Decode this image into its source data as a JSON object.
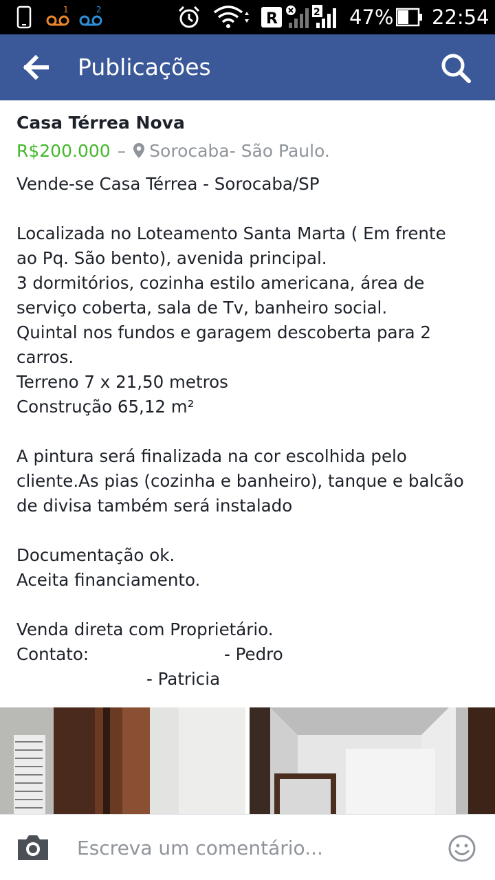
{
  "status_bar": {
    "battery_percent": "47%",
    "time": "22:54",
    "icons": [
      "phone-icon",
      "voicemail-icon",
      "voicemail-2-icon",
      "alarm-icon",
      "wifi-icon",
      "roaming-r-icon",
      "signal-muted-icon",
      "signal-2-icon",
      "battery-icon"
    ]
  },
  "app_bar": {
    "title": "Publicações",
    "back_icon": "arrow-left-icon",
    "search_icon": "search-icon",
    "color": "#3b5998"
  },
  "post": {
    "title": "Casa Térrea Nova",
    "price": "R$200.000",
    "separator": "–",
    "location": "Sorocaba- São Paulo.",
    "price_color": "#42b72a",
    "description": {
      "l1": "Vende-se Casa Térrea - Sorocaba/SP",
      "l2": "Localizada no Loteamento Santa Marta ( Em frente",
      "l3": "ao Pq. São bento), avenida principal.",
      "l4": "3 dormitórios, cozinha estilo americana, área de",
      "l5": "serviço coberta, sala de Tv, banheiro social.",
      "l6": "Quintal nos fundos e garagem descoberta para 2",
      "l7": "carros.",
      "l8": "Terreno 7 x 21,50 metros",
      "l9": "Construção 65,12 m²",
      "l10": "A pintura será finalizada na cor escolhida pelo",
      "l11": "cliente.As pias (cozinha e banheiro), tanque e balcão",
      "l12": "de divisa também será instalado",
      "l13": "Documentação ok.",
      "l14": "Aceita financiamento.",
      "l15": "Venda direta com Proprietário.",
      "contact_label": "Contato:",
      "contact_1": "- Pedro",
      "contact_2": "- Patricia"
    }
  },
  "comment_bar": {
    "placeholder": "Escreva um comentário...",
    "camera_icon": "camera-icon",
    "emoji_icon": "smiley-icon"
  }
}
